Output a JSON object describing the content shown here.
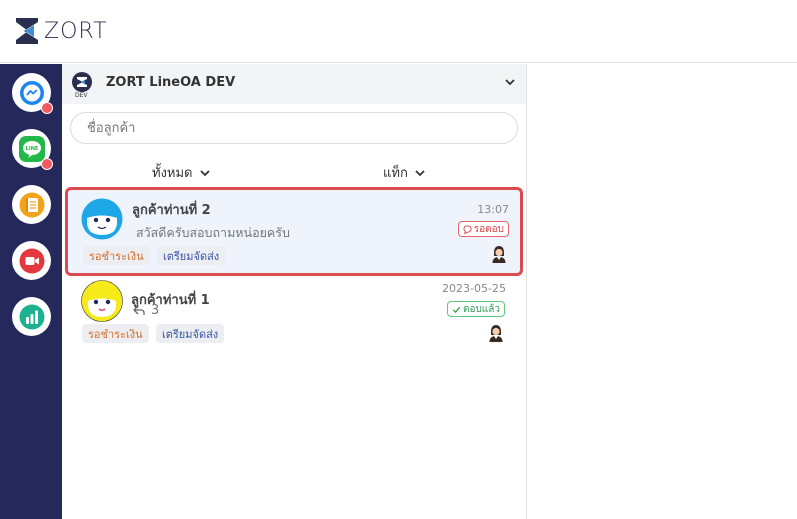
{
  "brand": {
    "name": "ZORT"
  },
  "sidebar": {
    "items": [
      {
        "name": "messenger",
        "icon": "messenger-icon",
        "notify": true
      },
      {
        "name": "line",
        "icon": "line-icon",
        "notify": true
      },
      {
        "name": "notes",
        "icon": "notebook-icon",
        "notify": false
      },
      {
        "name": "video",
        "icon": "video-camera-icon",
        "notify": false
      },
      {
        "name": "analytics",
        "icon": "bar-chart-icon",
        "notify": false
      }
    ]
  },
  "channel": {
    "name": "ZORT LineOA DEV",
    "logo_label": "DEV"
  },
  "search": {
    "placeholder": "ชื่อลูกค้า"
  },
  "filters": {
    "all_label": "ทั้งหมด",
    "tag_label": "แท็ก"
  },
  "chats": [
    {
      "name": "ลูกค้าท่านที่ 2",
      "time": "13:07",
      "message": "สวัสดีครับสอบถามหน่อยครับ",
      "status": "รอตอบ",
      "tags": [
        "รอชำระเงิน",
        "เตรียมจัดส่ง"
      ],
      "avatar_color": "#1ea7e6",
      "selected": true
    },
    {
      "name": "ลูกค้าท่านที่ 1",
      "time": "2023-05-25",
      "reply_count": "3",
      "status": "ตอบแล้ว",
      "tags": [
        "รอชำระเงิน",
        "เตรียมจัดส่ง"
      ],
      "avatar_color": "#f7ea1b",
      "selected": false
    }
  ],
  "colors": {
    "sidebar_bg": "#24285a",
    "notify_dot": "#ef5a63",
    "selected_border": "#dc4b50",
    "selected_bg": "#eef3fc"
  }
}
